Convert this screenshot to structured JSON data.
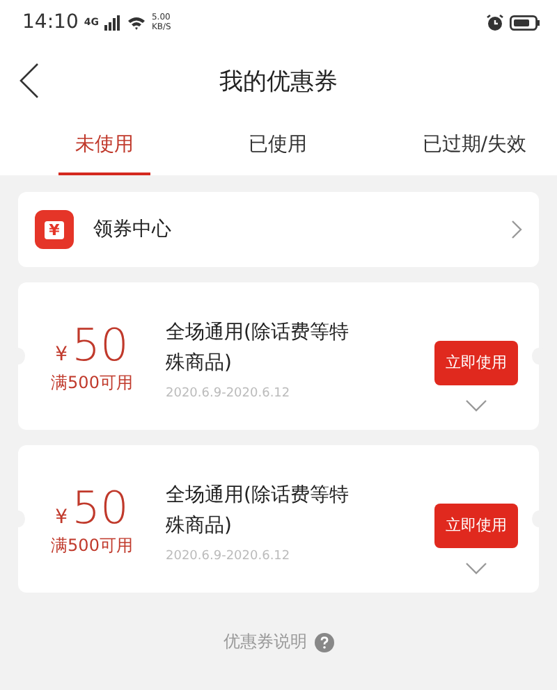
{
  "status_bar": {
    "time": "14:10",
    "network": "4G",
    "speed": [
      "5.00",
      "KB/S"
    ]
  },
  "header": {
    "title": "我的优惠券"
  },
  "tabs": [
    {
      "label": "未使用",
      "selected": true
    },
    {
      "label": "已使用",
      "selected": false
    },
    {
      "label": "已过期/失效",
      "selected": false
    }
  ],
  "coupon_center": {
    "icon": "¥",
    "label": "领券中心"
  },
  "coupons": [
    {
      "currency": "¥",
      "amount": "50",
      "condition": "满500可用",
      "title": "全场通用(除话费等特殊商品)",
      "dates": "2020.6.9-2020.6.12",
      "button": "立即使用"
    },
    {
      "currency": "¥",
      "amount": "50",
      "condition": "满500可用",
      "title": "全场通用(除话费等特殊商品)",
      "dates": "2020.6.9-2020.6.12",
      "button": "立即使用"
    }
  ],
  "footer_link": "优惠券说明"
}
